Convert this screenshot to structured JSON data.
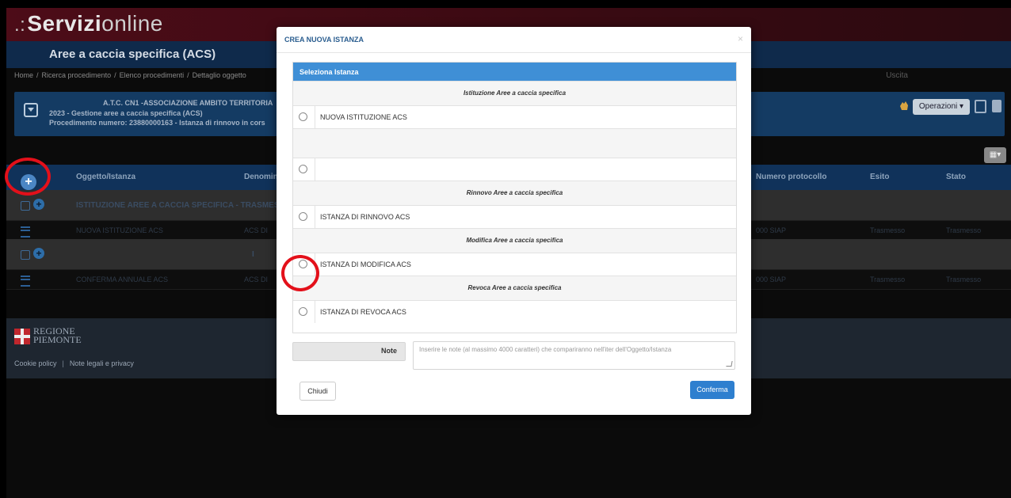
{
  "app": {
    "logo": {
      "dots": ".:",
      "bold": "Servizi",
      "thin": "online"
    },
    "title": "Aree a caccia specifica (ACS)",
    "breadcrumb": [
      "Home",
      "Ricerca procedimento",
      "Elenco procedimenti",
      "Dettaglio oggetto"
    ],
    "uscita": "Uscita"
  },
  "info": {
    "line1": "A.T.C. CN1 -ASSOCIAZIONE AMBITO TERRITORIA",
    "line2": "2023 - Gestione aree a caccia specifica (ACS)",
    "line3": "Procedimento numero: 23880000163 - Istanza di rinnovo in cors",
    "operations_label": "Operazioni ▾"
  },
  "table": {
    "columns": [
      "Oggetto/Istanza",
      "Denomina",
      "Numero protocollo",
      "Esito",
      "Stato"
    ],
    "group1": "ISTITUZIONE AREE A CACCIA SPECIFICA - TRASMESSO",
    "row1": {
      "oggetto": "NUOVA ISTITUZIONE ACS",
      "denom": "ACS DI",
      "protocollo": "000 SIAP",
      "esito": "Trasmesso",
      "stato": "Trasmesso"
    },
    "group2": "I",
    "row2": {
      "oggetto": "CONFERMA ANNUALE ACS",
      "denom": "ACS DI",
      "protocollo": "000 SIAP",
      "esito": "Trasmesso",
      "stato": "Trasmesso"
    }
  },
  "footer": {
    "regione_line1": "REGIONE",
    "regione_line2": "PIEMONTE",
    "cookie": "Cookie policy",
    "legal": "Note legali e privacy"
  },
  "modal": {
    "title": "CREA NUOVA ISTANZA",
    "close": "×",
    "panel_title": "Seleziona Istanza",
    "sections": {
      "istituzione": "Istituzione Aree a caccia specifica",
      "rinnovo": "Rinnovo Aree a caccia specifica",
      "modifica": "Modifica Aree a caccia specifica",
      "revoca": "Revoca Aree a caccia specifica"
    },
    "options": {
      "nuova": "NUOVA ISTITUZIONE ACS",
      "empty": "",
      "rinnovo": "ISTANZA DI RINNOVO ACS",
      "modifica": "ISTANZA DI MODIFICA ACS",
      "revoca": "ISTANZA DI REVOCA ACS"
    },
    "note_label": "Note",
    "note_placeholder": "Inserire le note (al massimo 4000 caratteri) che compariranno nell'iter dell'Oggetto/Istanza",
    "btn_close": "Chiudi",
    "btn_confirm": "Conferma"
  },
  "colors": {
    "accent": "#3f8fd6",
    "annotation": "#e3101a",
    "confirm": "#2e7fcf"
  }
}
